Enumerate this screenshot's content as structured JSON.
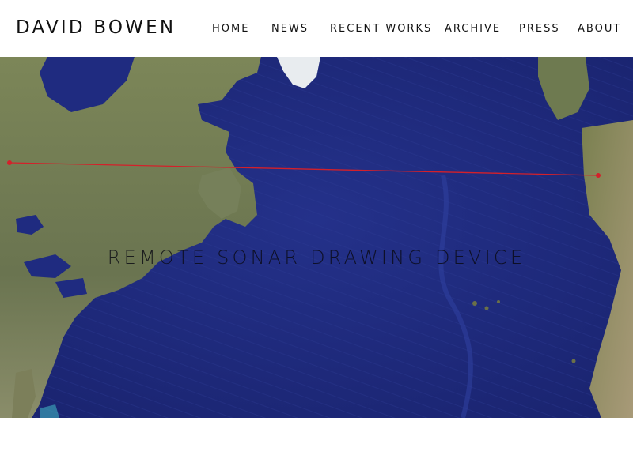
{
  "site": {
    "title": "DAVID BOWEN"
  },
  "nav": {
    "items": [
      {
        "label": "HOME"
      },
      {
        "label": "NEWS"
      },
      {
        "label": "RECENT WORKS"
      },
      {
        "label": "ARCHIVE"
      },
      {
        "label": "PRESS"
      },
      {
        "label": "ABOUT"
      }
    ]
  },
  "hero": {
    "title": "REMOTE SONAR DRAWING DEVICE",
    "ocean_color": "#1f2b80",
    "land_color": "#6f7a52",
    "route_line_color": "#d4202a"
  }
}
